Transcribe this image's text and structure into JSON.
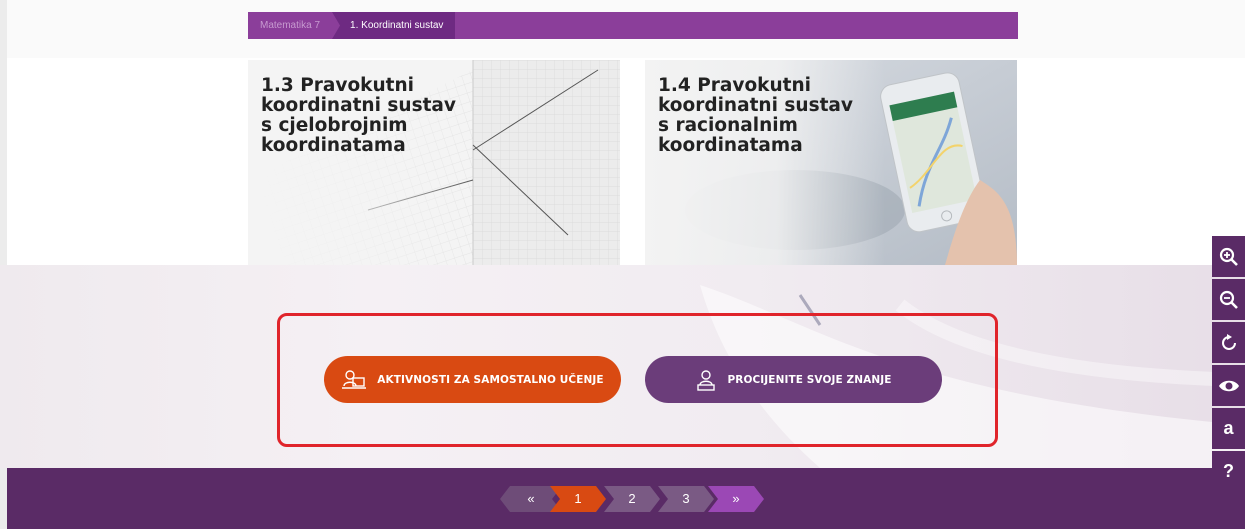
{
  "breadcrumb": {
    "items": [
      "Matematika 7",
      "1. Koordinatni sustav"
    ]
  },
  "cards": [
    {
      "title": "1.3 Pravokutni koordinatni sustav s cjelobrojnim koordinatama"
    },
    {
      "title": "1.4 Pravokutni koordinatni sustav s racionalnim koordinatama"
    }
  ],
  "actions": {
    "self_study": "AKTIVNOSTI ZA SAMOSTALNO UČENJE",
    "assess": "PROCIJENITE SVOJE ZNANJE"
  },
  "pagination": {
    "prev": "«",
    "pages": [
      "1",
      "2",
      "3"
    ],
    "next": "»",
    "current": "1"
  },
  "toolbar": {
    "zoom_in": "zoom-in-icon",
    "zoom_out": "zoom-out-icon",
    "reset": "reset-icon",
    "view": "eye-icon",
    "font": "a",
    "help": "?"
  },
  "colors": {
    "purple": "#8b3e9a",
    "dark_purple": "#5a2b66",
    "orange": "#d94a12",
    "highlight_red": "#e0242b"
  }
}
